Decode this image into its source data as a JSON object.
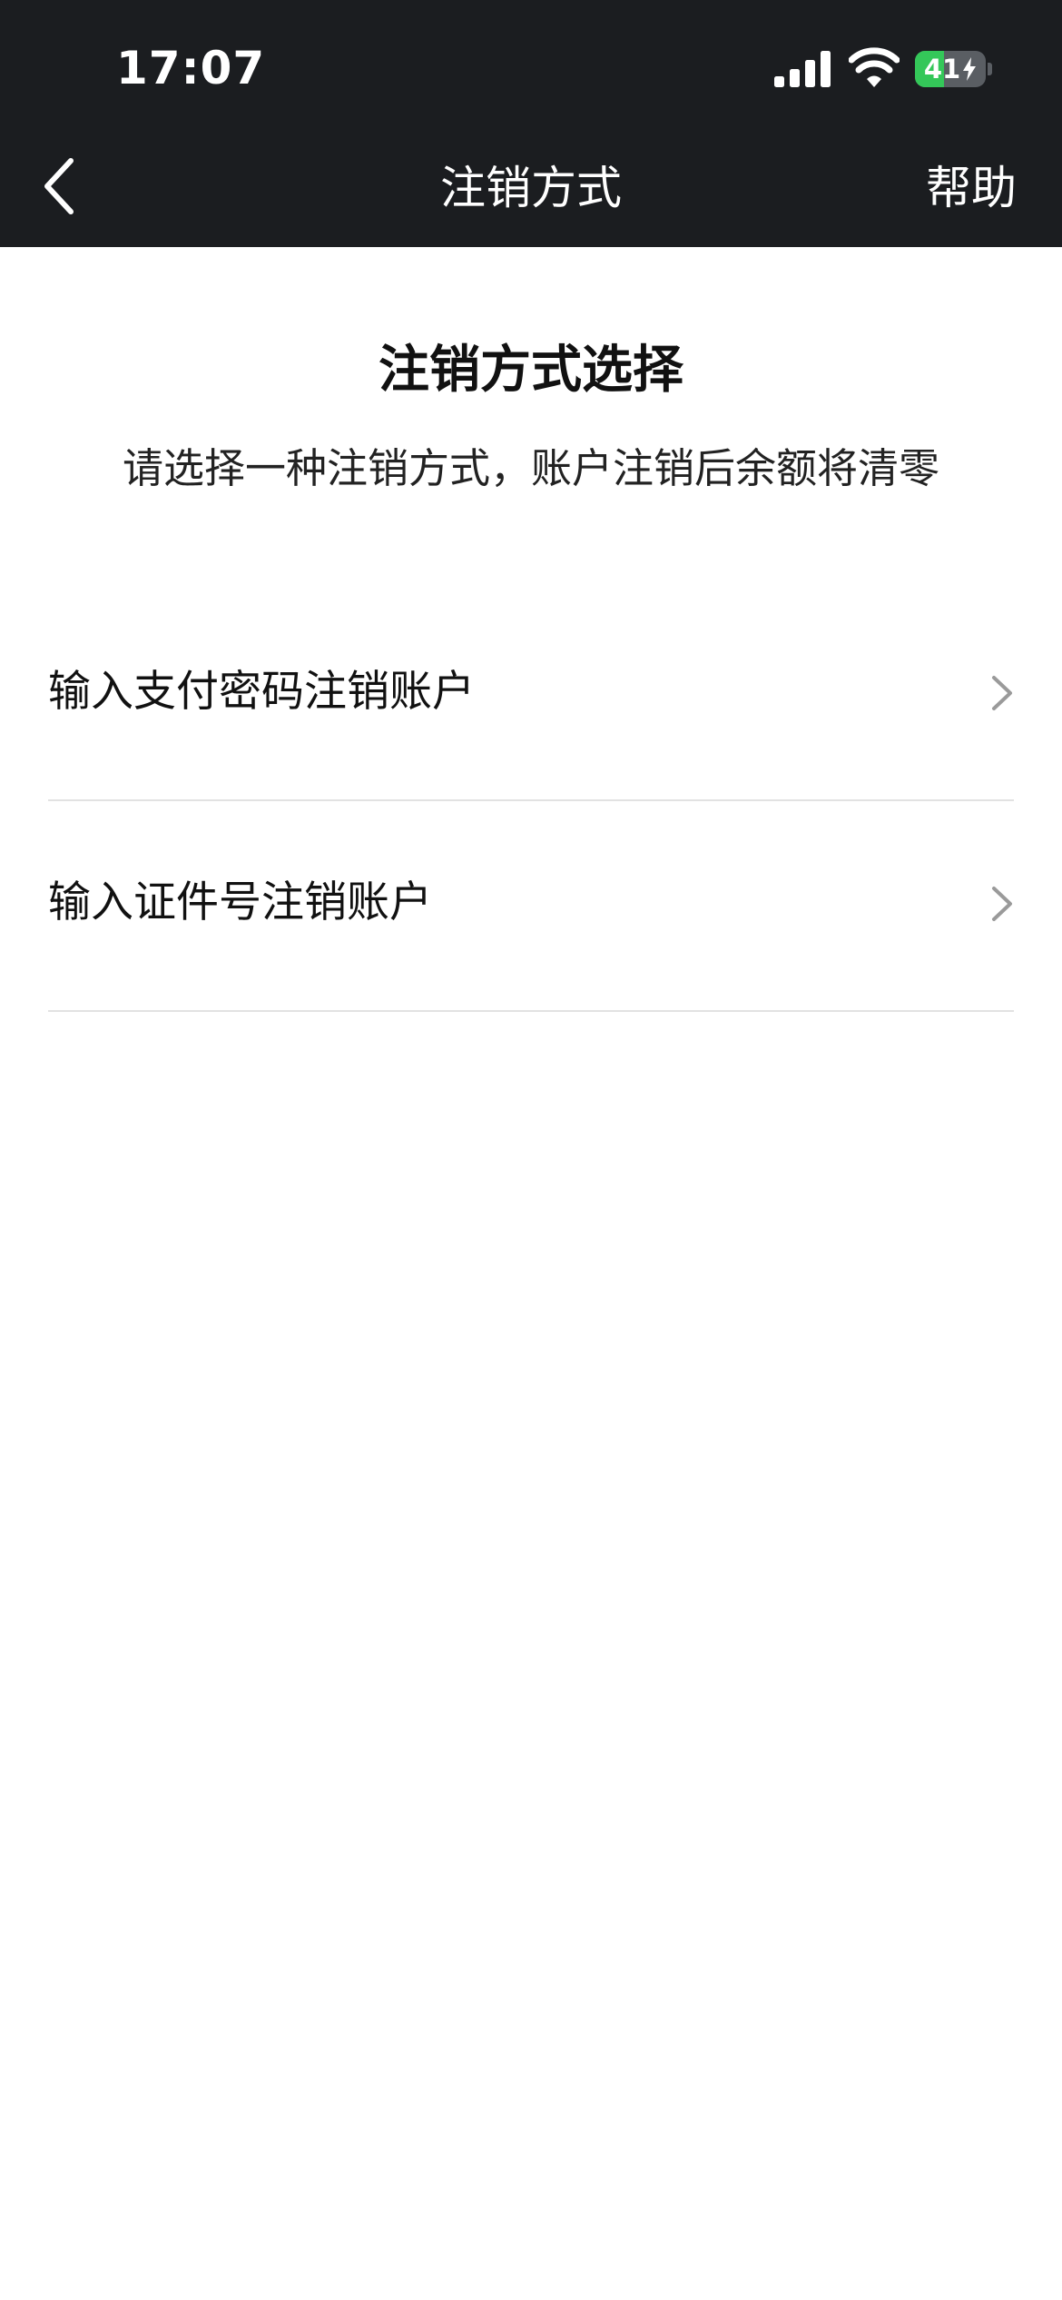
{
  "status_bar": {
    "time": "17:07",
    "battery_level": "41",
    "battery_fraction": 0.41,
    "icons": [
      "signal-icon",
      "wifi-icon",
      "battery-charging-icon"
    ]
  },
  "nav": {
    "back_icon": "chevron-left-icon",
    "title": "注销方式",
    "help_label": "帮助"
  },
  "content": {
    "title": "注销方式选择",
    "subtitle": "请选择一种注销方式，账户注销后余额将清零",
    "options": [
      {
        "label": "输入支付密码注销账户",
        "icon": "chevron-right-icon"
      },
      {
        "label": "输入证件号注销账户",
        "icon": "chevron-right-icon"
      }
    ]
  },
  "colors": {
    "header_background": "#1b1d20",
    "page_background": "#ffffff",
    "battery_green": "#34c759",
    "divider": "#e2e2e2",
    "chevron": "#9a9a9a"
  }
}
